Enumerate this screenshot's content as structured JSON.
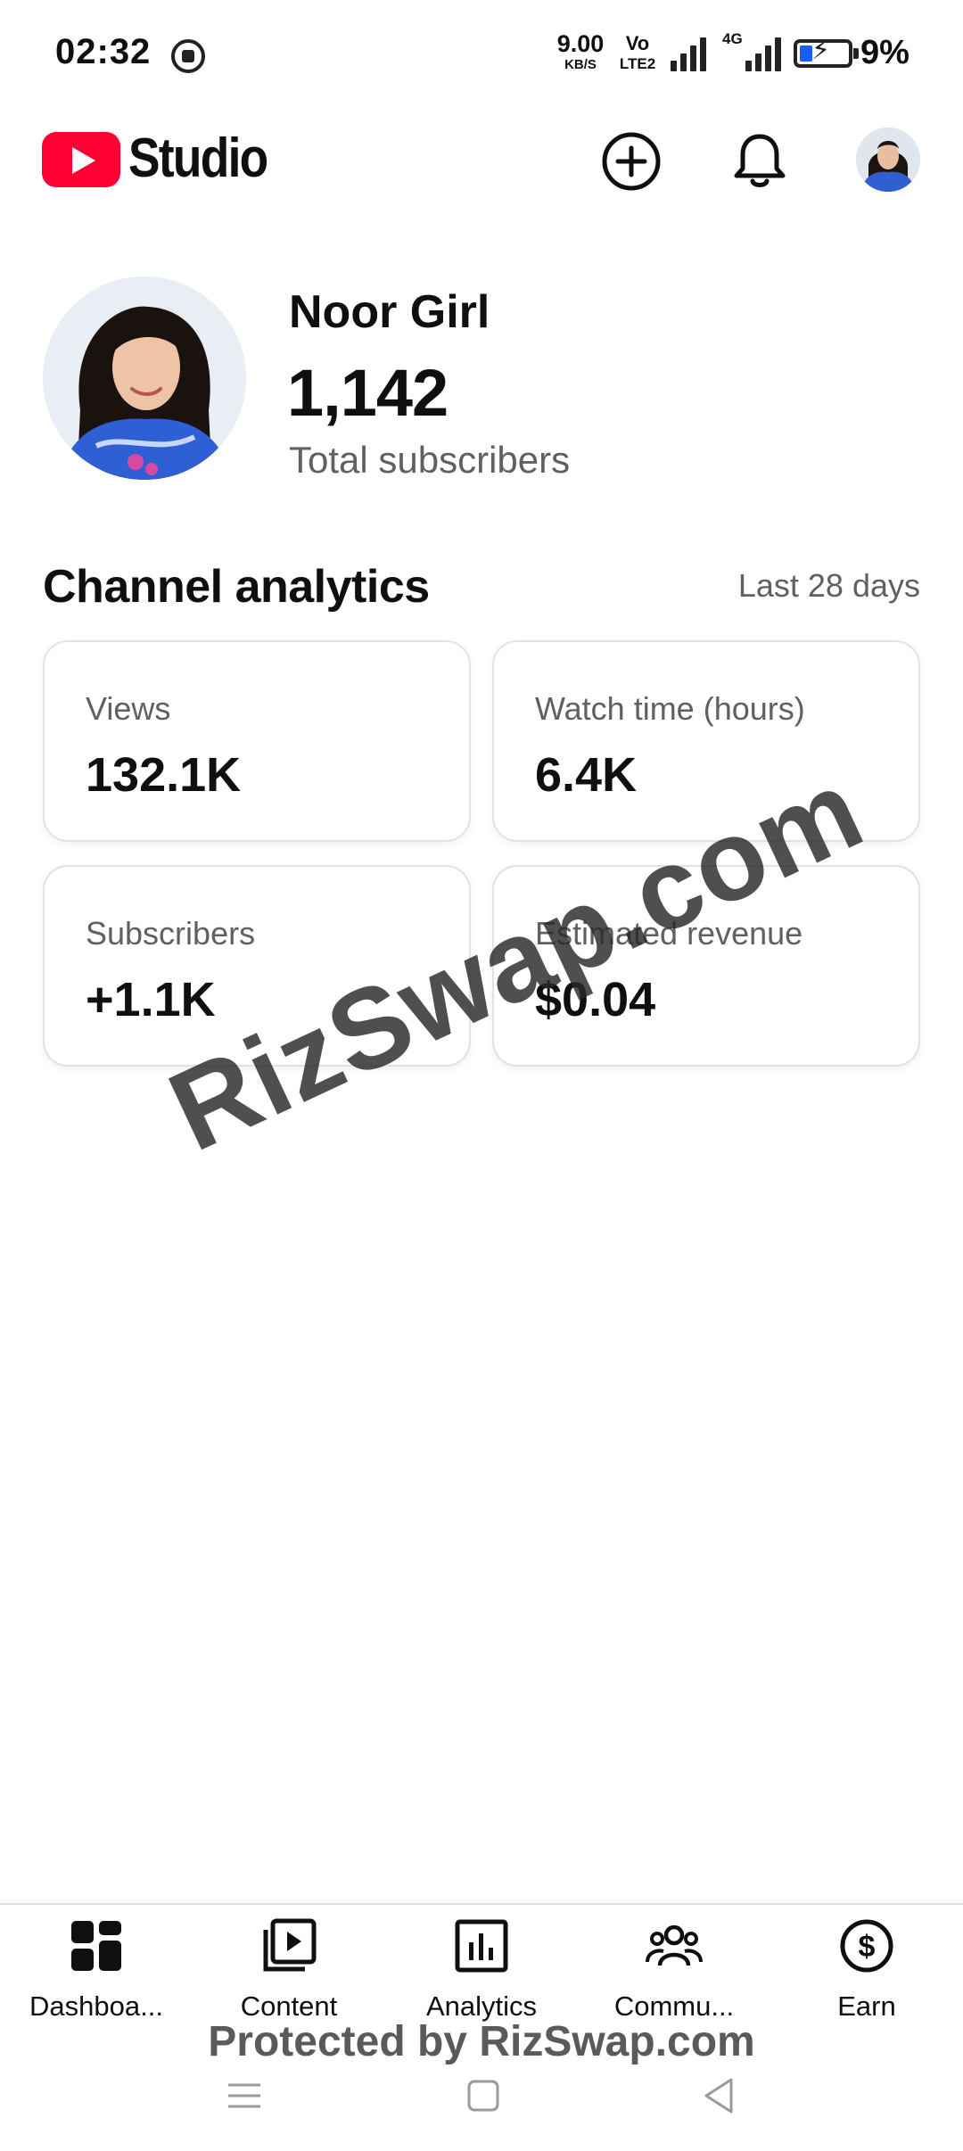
{
  "status_bar": {
    "time": "02:32",
    "net_speed_value": "9.00",
    "net_speed_unit": "KB/S",
    "volte_top": "Vo",
    "volte_bottom": "LTE2",
    "network_tag": "4G",
    "battery_percent": "9%",
    "battery_level": 0.09,
    "icons": [
      "screen-record-icon",
      "signal-icon",
      "battery-charging-icon"
    ]
  },
  "header": {
    "app_name": "Studio",
    "icons": [
      "youtube-logo-icon",
      "create-plus-icon",
      "notification-bell-icon",
      "account-avatar"
    ]
  },
  "channel": {
    "name": "Noor Girl",
    "subscriber_count": "1,142",
    "subscriber_label": "Total subscribers"
  },
  "analytics": {
    "title": "Channel analytics",
    "period": "Last 28 days",
    "cards": [
      {
        "label": "Views",
        "value": "132.1K"
      },
      {
        "label": "Watch time (hours)",
        "value": "6.4K"
      },
      {
        "label": "Subscribers",
        "value": "+1.1K"
      },
      {
        "label": "Estimated revenue",
        "value": "$0.04"
      }
    ]
  },
  "watermark": {
    "text": "RizSwap.com",
    "footer": "Protected by RizSwap.com"
  },
  "bottom_nav": [
    {
      "label": "Dashboa...",
      "icon": "dashboard-icon"
    },
    {
      "label": "Content",
      "icon": "content-icon"
    },
    {
      "label": "Analytics",
      "icon": "analytics-icon"
    },
    {
      "label": "Commu...",
      "icon": "community-icon"
    },
    {
      "label": "Earn",
      "icon": "earn-dollar-icon"
    }
  ],
  "system_nav": [
    "menu-icon",
    "home-icon",
    "back-icon"
  ],
  "colors": {
    "brand_red": "#ff0033",
    "text_primary": "#0f0f0f",
    "text_secondary": "#606060",
    "battery_fill": "#1a5cff"
  }
}
